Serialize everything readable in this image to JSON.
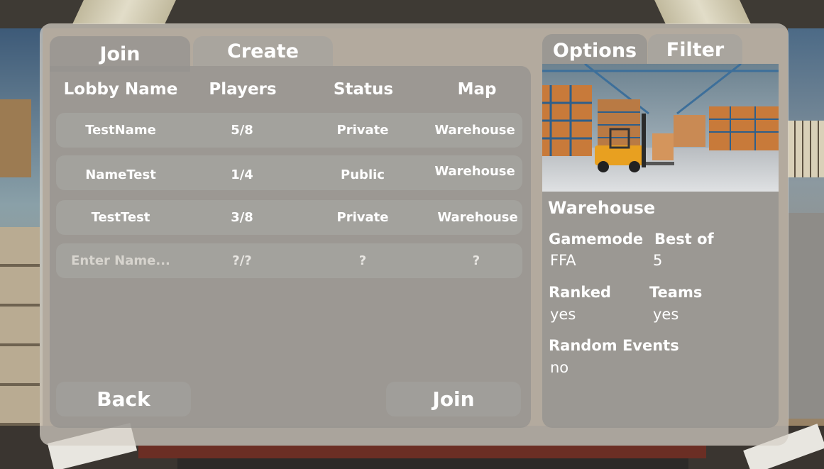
{
  "tabs": {
    "join": "Join",
    "create": "Create",
    "options": "Options",
    "filter": "Filter"
  },
  "table": {
    "headers": [
      "Lobby Name",
      "Players",
      "Status",
      "Map"
    ],
    "rows": [
      {
        "name": "TestName",
        "players": "5/8",
        "status": "Private",
        "map": "Warehouse"
      },
      {
        "name": "NameTest",
        "players": "1/4",
        "status": "Public",
        "map": "Warehouse"
      },
      {
        "name": "TestTest",
        "players": "3/8",
        "status": "Private",
        "map": "Warehouse"
      }
    ],
    "new_row": {
      "placeholder": "Enter Name...",
      "players": "?/?",
      "status": "?",
      "map": "?"
    }
  },
  "buttons": {
    "back": "Back",
    "join": "Join"
  },
  "options": {
    "map_title": "Warehouse",
    "gamemode_label": "Gamemode",
    "gamemode_value": "FFA",
    "bestof_label": "Best of",
    "bestof_value": "5",
    "ranked_label": "Ranked",
    "ranked_value": "yes",
    "teams_label": "Teams",
    "teams_value": "yes",
    "random_label": "Random Events",
    "random_value": "no"
  },
  "colors": {
    "panel": "#d6d0c6",
    "row": "#a5a39f",
    "text": "#ffffff",
    "forklift": "#e8a020"
  }
}
